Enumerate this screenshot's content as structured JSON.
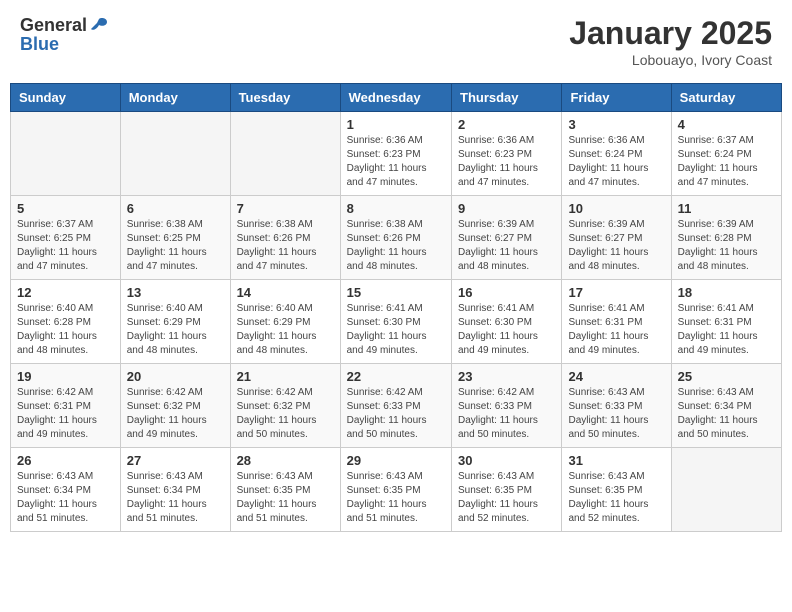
{
  "header": {
    "logo_general": "General",
    "logo_blue": "Blue",
    "month_title": "January 2025",
    "subtitle": "Lobouayo, Ivory Coast"
  },
  "days_of_week": [
    "Sunday",
    "Monday",
    "Tuesday",
    "Wednesday",
    "Thursday",
    "Friday",
    "Saturday"
  ],
  "weeks": [
    [
      {
        "day": "",
        "info": ""
      },
      {
        "day": "",
        "info": ""
      },
      {
        "day": "",
        "info": ""
      },
      {
        "day": "1",
        "info": "Sunrise: 6:36 AM\nSunset: 6:23 PM\nDaylight: 11 hours and 47 minutes."
      },
      {
        "day": "2",
        "info": "Sunrise: 6:36 AM\nSunset: 6:23 PM\nDaylight: 11 hours and 47 minutes."
      },
      {
        "day": "3",
        "info": "Sunrise: 6:36 AM\nSunset: 6:24 PM\nDaylight: 11 hours and 47 minutes."
      },
      {
        "day": "4",
        "info": "Sunrise: 6:37 AM\nSunset: 6:24 PM\nDaylight: 11 hours and 47 minutes."
      }
    ],
    [
      {
        "day": "5",
        "info": "Sunrise: 6:37 AM\nSunset: 6:25 PM\nDaylight: 11 hours and 47 minutes."
      },
      {
        "day": "6",
        "info": "Sunrise: 6:38 AM\nSunset: 6:25 PM\nDaylight: 11 hours and 47 minutes."
      },
      {
        "day": "7",
        "info": "Sunrise: 6:38 AM\nSunset: 6:26 PM\nDaylight: 11 hours and 47 minutes."
      },
      {
        "day": "8",
        "info": "Sunrise: 6:38 AM\nSunset: 6:26 PM\nDaylight: 11 hours and 48 minutes."
      },
      {
        "day": "9",
        "info": "Sunrise: 6:39 AM\nSunset: 6:27 PM\nDaylight: 11 hours and 48 minutes."
      },
      {
        "day": "10",
        "info": "Sunrise: 6:39 AM\nSunset: 6:27 PM\nDaylight: 11 hours and 48 minutes."
      },
      {
        "day": "11",
        "info": "Sunrise: 6:39 AM\nSunset: 6:28 PM\nDaylight: 11 hours and 48 minutes."
      }
    ],
    [
      {
        "day": "12",
        "info": "Sunrise: 6:40 AM\nSunset: 6:28 PM\nDaylight: 11 hours and 48 minutes."
      },
      {
        "day": "13",
        "info": "Sunrise: 6:40 AM\nSunset: 6:29 PM\nDaylight: 11 hours and 48 minutes."
      },
      {
        "day": "14",
        "info": "Sunrise: 6:40 AM\nSunset: 6:29 PM\nDaylight: 11 hours and 48 minutes."
      },
      {
        "day": "15",
        "info": "Sunrise: 6:41 AM\nSunset: 6:30 PM\nDaylight: 11 hours and 49 minutes."
      },
      {
        "day": "16",
        "info": "Sunrise: 6:41 AM\nSunset: 6:30 PM\nDaylight: 11 hours and 49 minutes."
      },
      {
        "day": "17",
        "info": "Sunrise: 6:41 AM\nSunset: 6:31 PM\nDaylight: 11 hours and 49 minutes."
      },
      {
        "day": "18",
        "info": "Sunrise: 6:41 AM\nSunset: 6:31 PM\nDaylight: 11 hours and 49 minutes."
      }
    ],
    [
      {
        "day": "19",
        "info": "Sunrise: 6:42 AM\nSunset: 6:31 PM\nDaylight: 11 hours and 49 minutes."
      },
      {
        "day": "20",
        "info": "Sunrise: 6:42 AM\nSunset: 6:32 PM\nDaylight: 11 hours and 49 minutes."
      },
      {
        "day": "21",
        "info": "Sunrise: 6:42 AM\nSunset: 6:32 PM\nDaylight: 11 hours and 50 minutes."
      },
      {
        "day": "22",
        "info": "Sunrise: 6:42 AM\nSunset: 6:33 PM\nDaylight: 11 hours and 50 minutes."
      },
      {
        "day": "23",
        "info": "Sunrise: 6:42 AM\nSunset: 6:33 PM\nDaylight: 11 hours and 50 minutes."
      },
      {
        "day": "24",
        "info": "Sunrise: 6:43 AM\nSunset: 6:33 PM\nDaylight: 11 hours and 50 minutes."
      },
      {
        "day": "25",
        "info": "Sunrise: 6:43 AM\nSunset: 6:34 PM\nDaylight: 11 hours and 50 minutes."
      }
    ],
    [
      {
        "day": "26",
        "info": "Sunrise: 6:43 AM\nSunset: 6:34 PM\nDaylight: 11 hours and 51 minutes."
      },
      {
        "day": "27",
        "info": "Sunrise: 6:43 AM\nSunset: 6:34 PM\nDaylight: 11 hours and 51 minutes."
      },
      {
        "day": "28",
        "info": "Sunrise: 6:43 AM\nSunset: 6:35 PM\nDaylight: 11 hours and 51 minutes."
      },
      {
        "day": "29",
        "info": "Sunrise: 6:43 AM\nSunset: 6:35 PM\nDaylight: 11 hours and 51 minutes."
      },
      {
        "day": "30",
        "info": "Sunrise: 6:43 AM\nSunset: 6:35 PM\nDaylight: 11 hours and 52 minutes."
      },
      {
        "day": "31",
        "info": "Sunrise: 6:43 AM\nSunset: 6:35 PM\nDaylight: 11 hours and 52 minutes."
      },
      {
        "day": "",
        "info": ""
      }
    ]
  ]
}
